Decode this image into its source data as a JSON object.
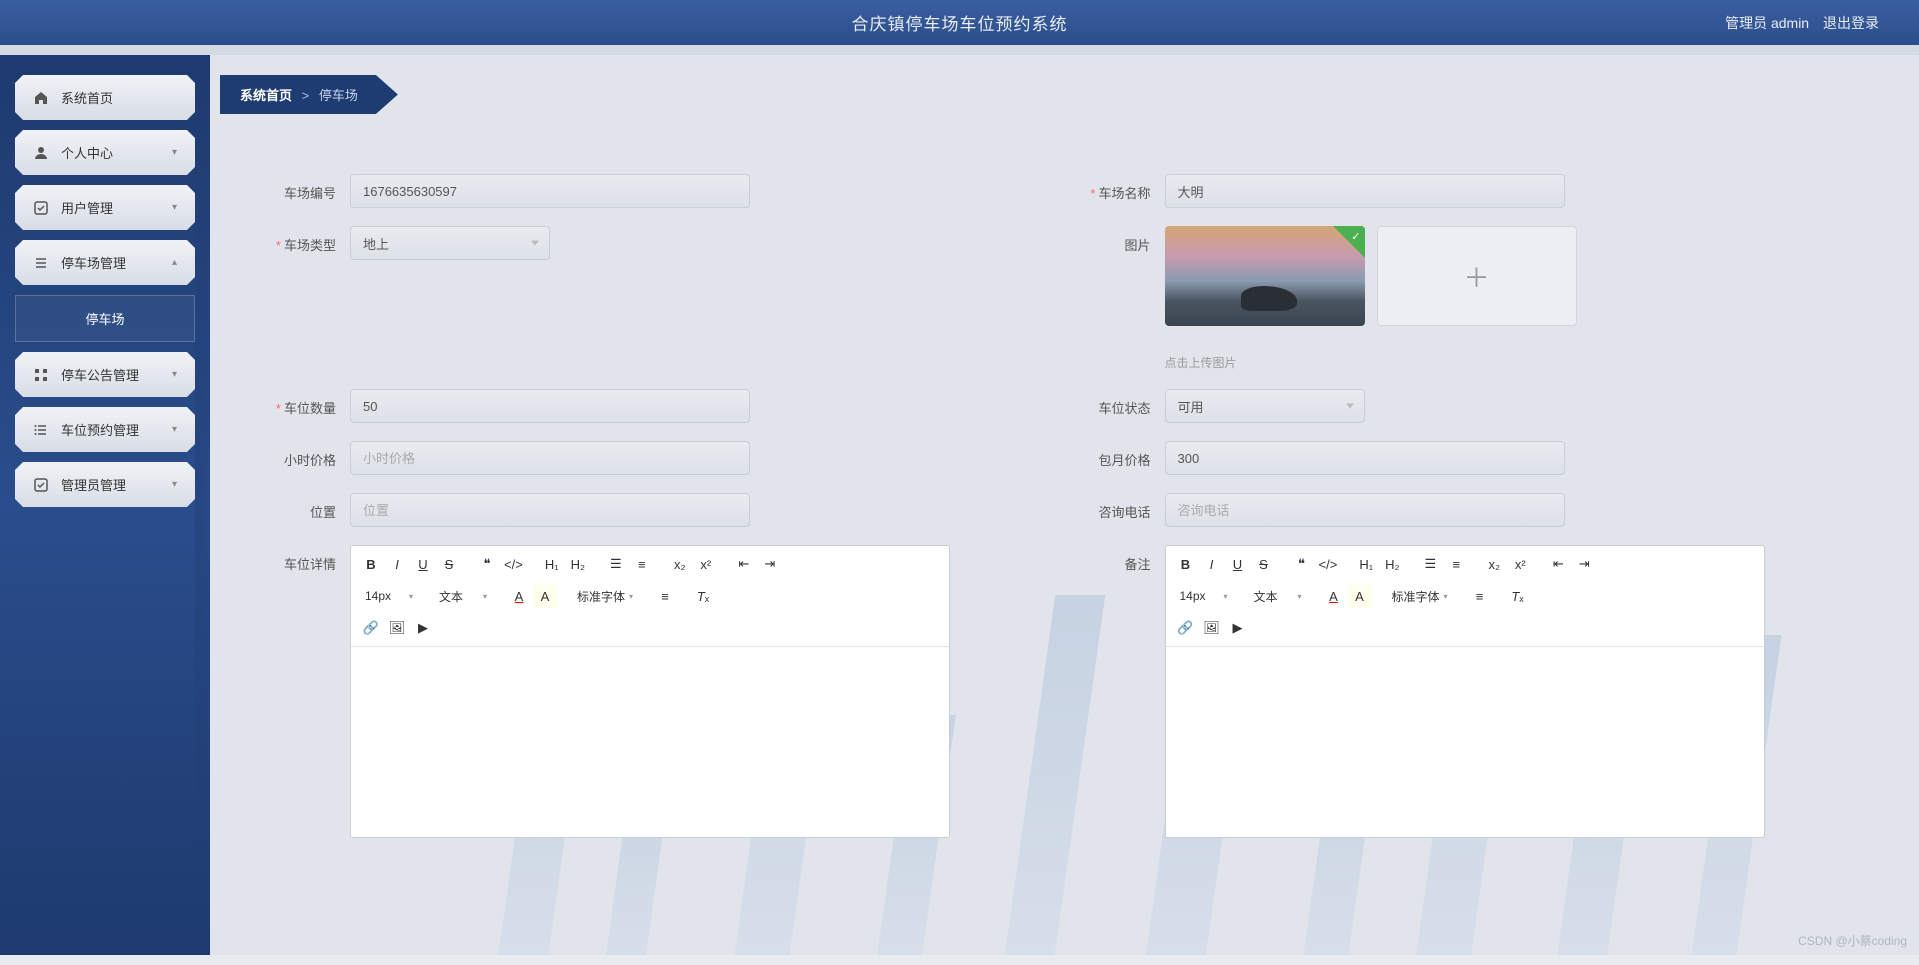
{
  "header": {
    "title": "合庆镇停车场车位预约系统",
    "admin_label": "管理员 admin",
    "logout": "退出登录"
  },
  "sidebar": {
    "items": [
      {
        "label": "系统首页",
        "icon": "home",
        "expand": false
      },
      {
        "label": "个人中心",
        "icon": "user",
        "expand": true
      },
      {
        "label": "用户管理",
        "icon": "check",
        "expand": true
      },
      {
        "label": "停车场管理",
        "icon": "menu",
        "expand": true,
        "open": true
      },
      {
        "label": "停车公告管理",
        "icon": "grid",
        "expand": true
      },
      {
        "label": "车位预约管理",
        "icon": "list",
        "expand": true
      },
      {
        "label": "管理员管理",
        "icon": "check",
        "expand": true
      }
    ],
    "sub_parking": "停车场"
  },
  "breadcrumb": {
    "home": "系统首页",
    "sep": ">",
    "current": "停车场"
  },
  "form": {
    "labels": {
      "number": "车场编号",
      "name": "车场名称",
      "type": "车场类型",
      "image": "图片",
      "img_tip": "点击上传图片",
      "count": "车位数量",
      "status": "车位状态",
      "hour_price": "小时价格",
      "month_price": "包月价格",
      "location": "位置",
      "phone": "咨询电话",
      "detail": "车位详情",
      "remark": "备注"
    },
    "values": {
      "number": "1676635630597",
      "name": "大明",
      "type": "地上",
      "count": "50",
      "status": "可用",
      "hour_price": "",
      "month_price": "300",
      "location": "",
      "phone": ""
    },
    "placeholders": {
      "hour_price": "小时价格",
      "location": "位置",
      "phone": "咨询电话"
    }
  },
  "editor": {
    "font_size": "14px",
    "text_type": "文本",
    "font_family": "标准字体"
  },
  "watermark": "CSDN @小蔡coding"
}
